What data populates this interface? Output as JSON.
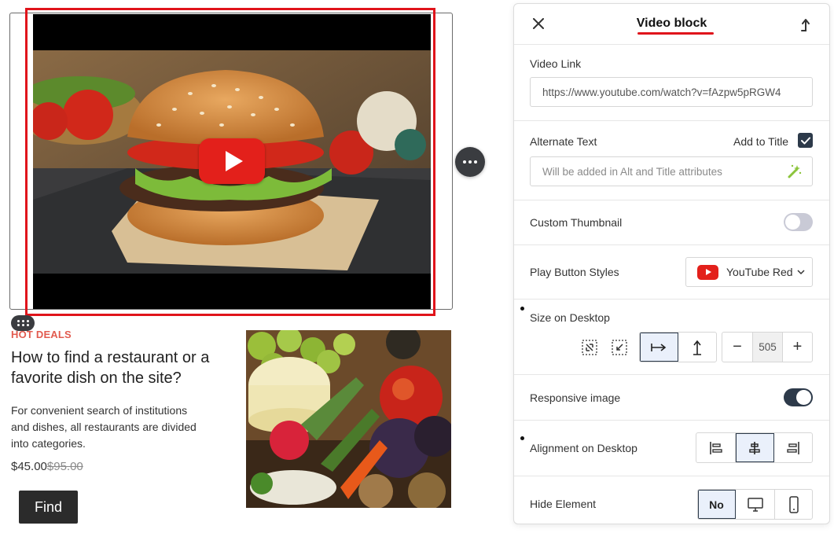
{
  "canvas": {
    "category": "HOT DEALS",
    "title": "How to find a restaurant or a favorite dish on the site?",
    "description": "For convenient search of institutions and dishes, all restaurants are divided into categories.",
    "price_current": "$45.00",
    "price_old": "$95.00",
    "find_label": "Find"
  },
  "panel": {
    "title": "Video block",
    "video_link": {
      "label": "Video Link",
      "value": "https://www.youtube.com/watch?v=fAzpw5pRGW4"
    },
    "alternate_text": {
      "label": "Alternate Text",
      "add_to_title_label": "Add to Title",
      "add_to_title_checked": true,
      "placeholder": "Will be added in Alt and Title attributes"
    },
    "custom_thumbnail": {
      "label": "Custom Thumbnail",
      "enabled": false
    },
    "play_button_styles": {
      "label": "Play Button Styles",
      "value": "YouTube Red"
    },
    "size_on_desktop": {
      "label": "Size on Desktop",
      "value": "505"
    },
    "responsive_image": {
      "label": "Responsive image",
      "enabled": true
    },
    "alignment_on_desktop": {
      "label": "Alignment on Desktop",
      "selected": "center"
    },
    "hide_element": {
      "label": "Hide Element",
      "no_label": "No"
    }
  },
  "colors": {
    "selection": "#e0141b",
    "accent_dark": "#2d3a4a",
    "youtube_red": "#e3201b",
    "hot_deals": "#e25b4f"
  }
}
